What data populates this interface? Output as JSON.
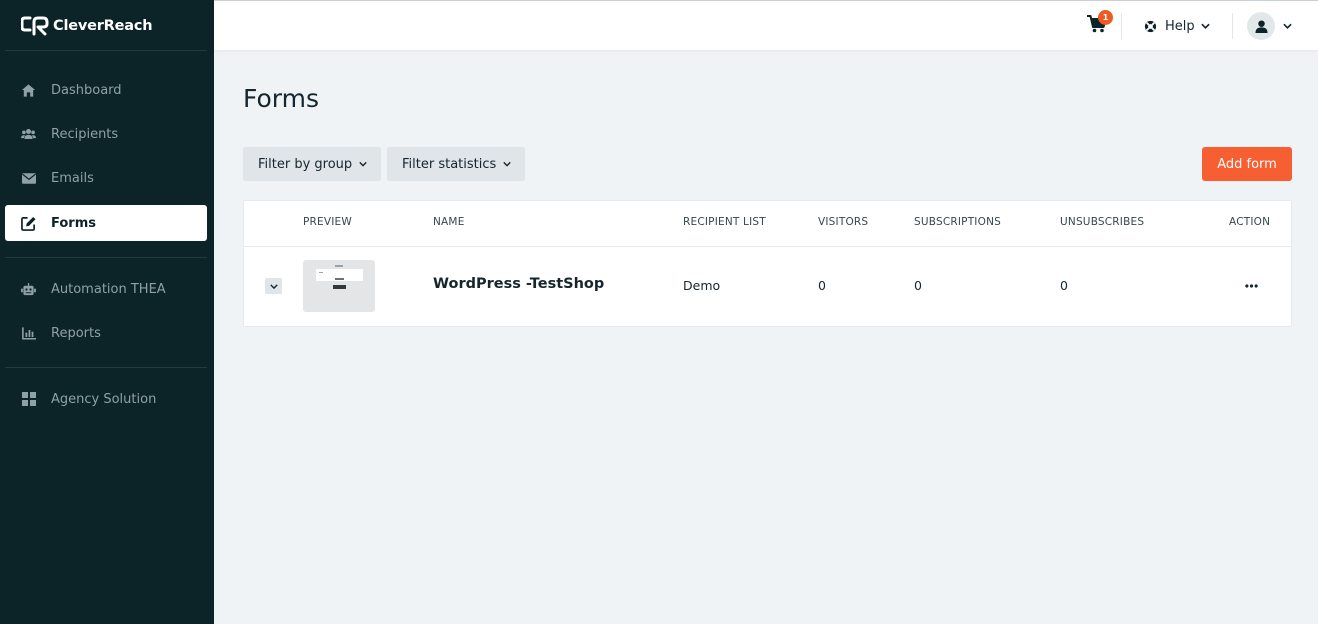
{
  "brand": {
    "name": "CleverReach"
  },
  "sidebar": {
    "items": [
      {
        "label": "Dashboard",
        "icon": "home-icon"
      },
      {
        "label": "Recipients",
        "icon": "users-icon"
      },
      {
        "label": "Emails",
        "icon": "envelope-icon"
      },
      {
        "label": "Forms",
        "icon": "edit-icon",
        "active": true
      },
      {
        "label": "Automation THEA",
        "icon": "robot-icon"
      },
      {
        "label": "Reports",
        "icon": "bar-chart-icon"
      },
      {
        "label": "Agency Solution",
        "icon": "grid-icon"
      }
    ]
  },
  "topbar": {
    "cart_count": "1",
    "help_label": "Help"
  },
  "main": {
    "title": "Forms",
    "filters": {
      "group_label": "Filter by group",
      "statistics_label": "Filter statistics"
    },
    "add_label": "Add form"
  },
  "table": {
    "columns": [
      "PREVIEW",
      "NAME",
      "RECIPIENT LIST",
      "VISITORS",
      "SUBSCRIPTIONS",
      "UNSUBSCRIBES",
      "ACTION"
    ],
    "rows": [
      {
        "name": "WordPress -TestShop",
        "recipient_list": "Demo",
        "visitors": "0",
        "subscriptions": "0",
        "unsubscribes": "0"
      }
    ]
  },
  "colors": {
    "sidebar_bg": "#0c2328",
    "accent": "#f75f32",
    "badge": "#f05a22",
    "page_bg": "#eff3f6"
  }
}
